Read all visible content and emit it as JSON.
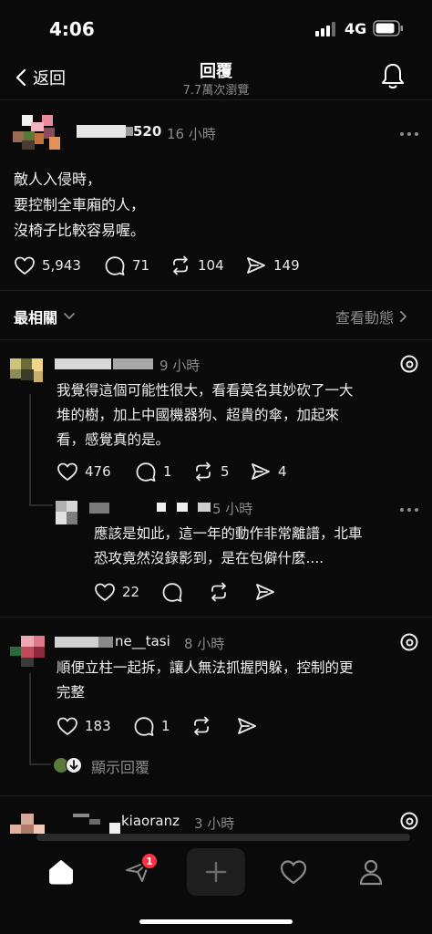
{
  "status_bar": {
    "time": "4:06",
    "network": "4G"
  },
  "header": {
    "back_label": "返回",
    "title": "回覆",
    "views": "7.7萬次瀏覽"
  },
  "post": {
    "username_suffix": "520",
    "time": "16 小時",
    "text_lines": [
      "敵人入侵時，",
      "要控制全車廂的人，",
      "沒椅子比較容易喔。"
    ],
    "likes": "5,943",
    "comments": "71",
    "reposts": "104",
    "shares": "149"
  },
  "sort": {
    "label": "最相關",
    "activity_label": "查看動態"
  },
  "replies": [
    {
      "time": "9 小時",
      "text_lines": [
        "我覺得這個可能性很大，看看莫名其妙砍了一大",
        "堆的樹，加上中國機器狗、超貴的傘，加起來",
        "看，感覺真的是。"
      ],
      "likes": "476",
      "comments": "1",
      "reposts": "5",
      "shares": "4"
    },
    {
      "time": "5 小時",
      "text_lines": [
        "應該是如此，這一年的動作非常離譜，北車",
        "恐攻竟然沒錄影到，是在包僻什麼...."
      ],
      "likes": "22"
    },
    {
      "username_suffix": "ne__tasi",
      "time": "8 小時",
      "text_lines": [
        "順便立柱一起拆，讓人無法抓握閃躲，控制的更",
        "完整"
      ],
      "likes": "183",
      "comments": "1",
      "show_replies": "顯示回覆"
    },
    {
      "username_suffix": "kiaoranz",
      "time": "3 小時"
    }
  ],
  "tabbar": {
    "activity_badge": "1"
  },
  "colors": {
    "background": "#0a0a0a",
    "badge": "#ff3040",
    "muted": "#8a8a8a"
  }
}
